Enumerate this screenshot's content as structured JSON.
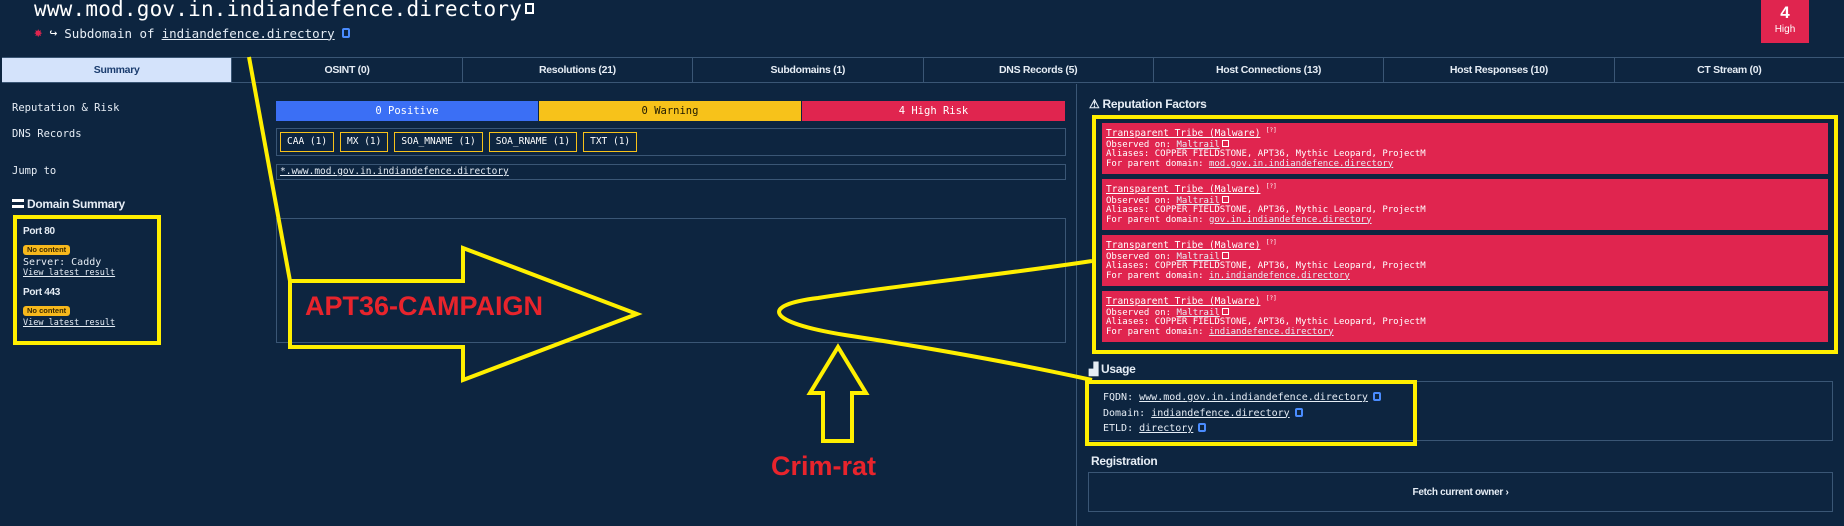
{
  "header": {
    "title": "www.mod.gov.in.indiandefence.directory",
    "subdomain_prefix": "Subdomain of",
    "parent_domain": "indiandefence.directory",
    "risk_count": "4",
    "risk_label": "High"
  },
  "tabs": [
    {
      "label": "Summary"
    },
    {
      "label": "OSINT (0)"
    },
    {
      "label": "Resolutions (21)"
    },
    {
      "label": "Subdomains (1)"
    },
    {
      "label": "DNS Records (5)"
    },
    {
      "label": "Host Connections (13)"
    },
    {
      "label": "Host Responses (10)"
    },
    {
      "label": "CT Stream (0)"
    }
  ],
  "left": {
    "reputation_label": "Reputation & Risk",
    "dns_label": "DNS Records",
    "jump_label": "Jump to",
    "domain_summary_title": "Domain Summary",
    "ports": [
      {
        "title": "Port 80",
        "badge": "No content",
        "server": "Server: Caddy",
        "link": "View latest result"
      },
      {
        "title": "Port 443",
        "badge": "No content",
        "link": "View latest result"
      }
    ]
  },
  "summary": {
    "positive": "0 Positive",
    "warning": "0 Warning",
    "high_risk": "4 High Risk",
    "dns_chips": [
      "CAA (1)",
      "MX (1)",
      "SOA_MNAME (1)",
      "SOA_RNAME (1)",
      "TXT (1)"
    ],
    "jump_path": "*.www.mod.gov.in.indiandefence.directory"
  },
  "reputation": {
    "title": "Reputation Factors",
    "items": [
      {
        "name": "Transparent Tribe (Malware)",
        "sup": "[?]",
        "observed_label": "Observed on:",
        "observed_on": "Maltrail",
        "aliases": "Aliases: COPPER FIELDSTONE, APT36, Mythic Leopard, ProjectM",
        "parent_label": "For parent domain:",
        "parent": "mod.gov.in.indiandefence.directory"
      },
      {
        "name": "Transparent Tribe (Malware)",
        "sup": "[?]",
        "observed_label": "Observed on:",
        "observed_on": "Maltrail",
        "aliases": "Aliases: COPPER FIELDSTONE, APT36, Mythic Leopard, ProjectM",
        "parent_label": "For parent domain:",
        "parent": "gov.in.indiandefence.directory"
      },
      {
        "name": "Transparent Tribe (Malware)",
        "sup": "[?]",
        "observed_label": "Observed on:",
        "observed_on": "Maltrail",
        "aliases": "Aliases: COPPER FIELDSTONE, APT36, Mythic Leopard, ProjectM",
        "parent_label": "For parent domain:",
        "parent": "in.indiandefence.directory"
      },
      {
        "name": "Transparent Tribe (Malware)",
        "sup": "[?]",
        "observed_label": "Observed on:",
        "observed_on": "Maltrail",
        "aliases": "Aliases: COPPER FIELDSTONE, APT36, Mythic Leopard, ProjectM",
        "parent_label": "For parent domain:",
        "parent": "indiandefence.directory"
      }
    ]
  },
  "usage": {
    "title": "Usage",
    "fqdn_label": "FQDN:",
    "fqdn": "www.mod.gov.in.indiandefence.directory",
    "domain_label": "Domain:",
    "domain": "indiandefence.directory",
    "etld_label": "ETLD:",
    "etld": "directory"
  },
  "registration": {
    "title": "Registration",
    "fetch_label": "Fetch current owner"
  },
  "annotations": {
    "campaign": "APT36-CAMPAIGN",
    "crim": "Crim-rat"
  },
  "colors": {
    "background": "#0d2540",
    "high_risk": "#e0254f",
    "warning": "#f7c21a",
    "positive": "#3b6ff5",
    "annotation_yellow": "#ffef00",
    "annotation_red": "#e8242c"
  }
}
